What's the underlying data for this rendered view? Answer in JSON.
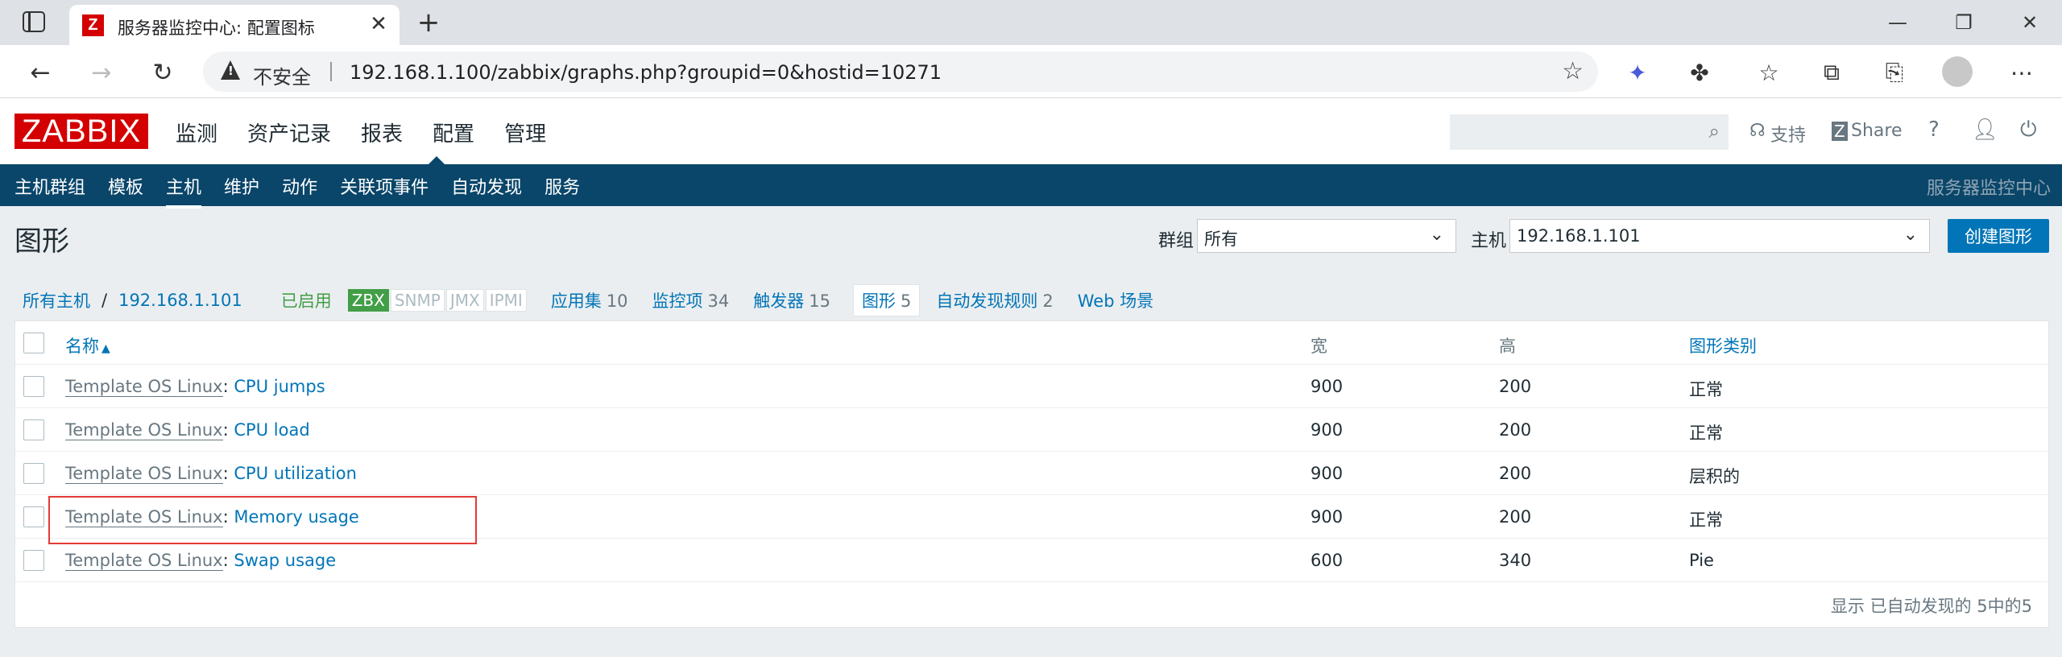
{
  "browser": {
    "tab_title": "服务器监控中心: 配置图标",
    "tab_favicon": "Z",
    "security_label": "不安全",
    "url": "192.168.1.100/zabbix/graphs.php?groupid=0&hostid=10271"
  },
  "header": {
    "logo": "ZABBIX",
    "main_menu": [
      "监测",
      "资产记录",
      "报表",
      "配置",
      "管理"
    ],
    "support": "支持",
    "share": "Share",
    "help": "?"
  },
  "submenu": {
    "items": [
      "主机群组",
      "模板",
      "主机",
      "维护",
      "动作",
      "关联项事件",
      "自动发现",
      "服务"
    ],
    "active": "主机",
    "right_label": "服务器监控中心"
  },
  "page": {
    "title": "图形",
    "group_label": "群组",
    "group_value": "所有",
    "host_label": "主机",
    "host_value": "192.168.1.101",
    "create_button": "创建图形"
  },
  "crumbs": {
    "all_hosts": "所有主机",
    "slash": "/",
    "host": "192.168.1.101",
    "status": "已启用",
    "availability": [
      "ZBX",
      "SNMP",
      "JMX",
      "IPMI"
    ],
    "apps": {
      "label": "应用集",
      "count": "10"
    },
    "items": {
      "label": "监控项",
      "count": "34"
    },
    "triggers": {
      "label": "触发器",
      "count": "15"
    },
    "graphs": {
      "label": "图形",
      "count": "5"
    },
    "discovery": {
      "label": "自动发现规则",
      "count": "2"
    },
    "web": {
      "label": "Web 场景"
    }
  },
  "table": {
    "columns": {
      "name": "名称",
      "sort": "▲",
      "width": "宽",
      "height": "高",
      "type": "图形类别"
    },
    "rows": [
      {
        "template": "Template OS Linux",
        "sep": ":",
        "name": "CPU jumps",
        "width": "900",
        "height": "200",
        "type": "正常"
      },
      {
        "template": "Template OS Linux",
        "sep": ":",
        "name": "CPU load",
        "width": "900",
        "height": "200",
        "type": "正常"
      },
      {
        "template": "Template OS Linux",
        "sep": ":",
        "name": "CPU utilization",
        "width": "900",
        "height": "200",
        "type": "层积的"
      },
      {
        "template": "Template OS Linux",
        "sep": ":",
        "name": "Memory usage",
        "width": "900",
        "height": "200",
        "type": "正常"
      },
      {
        "template": "Template OS Linux",
        "sep": ":",
        "name": "Swap usage",
        "width": "600",
        "height": "340",
        "type": "Pie"
      }
    ],
    "footer": "显示 已自动发现的 5中的5"
  },
  "colors": {
    "brand": "#d40000",
    "nav": "#0a466a",
    "link": "#0275b8",
    "enabled": "#429e47",
    "highlight": "#e53935"
  }
}
